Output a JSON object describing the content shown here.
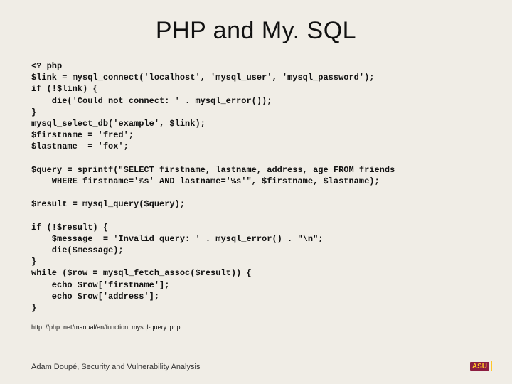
{
  "title": "PHP and My. SQL",
  "code": "<? php\n$link = mysql_connect('localhost', 'mysql_user', 'mysql_password');\nif (!$link) {\n    die('Could not connect: ' . mysql_error());\n}\nmysql_select_db('example', $link);\n$firstname = 'fred';\n$lastname  = 'fox';\n\n$query = sprintf(\"SELECT firstname, lastname, address, age FROM friends\n    WHERE firstname='%s' AND lastname='%s'\", $firstname, $lastname);\n\n$result = mysql_query($query);\n\nif (!$result) {\n    $message  = 'Invalid query: ' . mysql_error() . \"\\n\";\n    die($message);\n}\nwhile ($row = mysql_fetch_assoc($result)) {\n    echo $row['firstname'];\n    echo $row['address'];\n}",
  "url": "http: //php. net/manual/en/function. mysql-query. php",
  "footer": "Adam Doupé, Security and Vulnerability Analysis",
  "logo_text": "ASU"
}
